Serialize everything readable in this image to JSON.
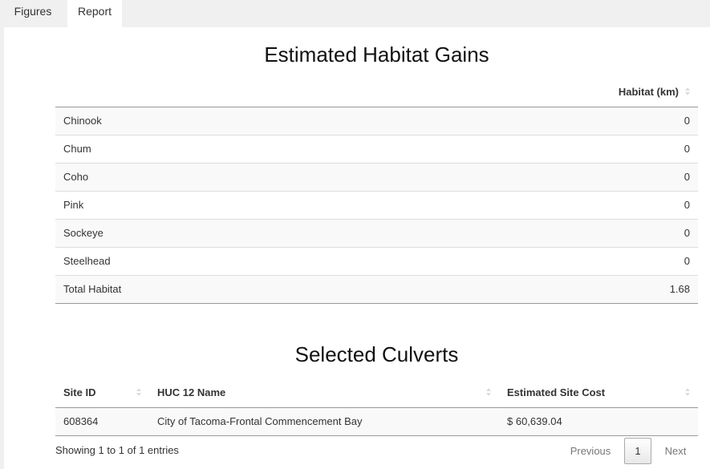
{
  "tabs": [
    {
      "label": "Figures"
    },
    {
      "label": "Report"
    }
  ],
  "habitat": {
    "title": "Estimated Habitat Gains",
    "header": "Habitat (km)",
    "rows": [
      {
        "name": "Chinook",
        "value": "0"
      },
      {
        "name": "Chum",
        "value": "0"
      },
      {
        "name": "Coho",
        "value": "0"
      },
      {
        "name": "Pink",
        "value": "0"
      },
      {
        "name": "Sockeye",
        "value": "0"
      },
      {
        "name": "Steelhead",
        "value": "0"
      },
      {
        "name": "Total Habitat",
        "value": "1.68"
      }
    ]
  },
  "culverts": {
    "title": "Selected Culverts",
    "headers": [
      "Site ID",
      "HUC 12 Name",
      "Estimated Site Cost"
    ],
    "rows": [
      {
        "site_id": "608364",
        "huc_name": "City of Tacoma-Frontal Commencement Bay",
        "cost": "$ 60,639.04"
      }
    ],
    "info": "Showing 1 to 1 of 1 entries",
    "pager": {
      "previous": "Previous",
      "current": "1",
      "next": "Next"
    }
  }
}
